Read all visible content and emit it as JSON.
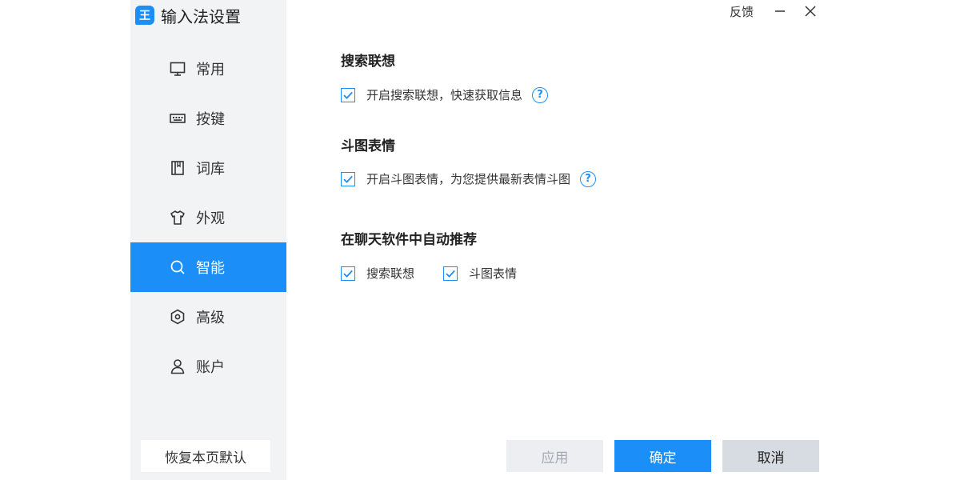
{
  "app": {
    "title": "输入法设置",
    "logo_glyph": "王",
    "accent": "#1b8ff7"
  },
  "topbar": {
    "feedback": "反馈"
  },
  "sidebar": {
    "items": [
      {
        "label": "常用",
        "icon": "monitor-icon"
      },
      {
        "label": "按键",
        "icon": "keyboard-icon"
      },
      {
        "label": "词库",
        "icon": "book-icon"
      },
      {
        "label": "外观",
        "icon": "shirt-icon"
      },
      {
        "label": "智能",
        "icon": "search-icon",
        "active": true
      },
      {
        "label": "高级",
        "icon": "hexagon-icon"
      },
      {
        "label": "账户",
        "icon": "user-icon"
      }
    ],
    "restore_label": "恢复本页默认"
  },
  "sections": {
    "search": {
      "title": "搜索联想",
      "option": "开启搜索联想，快速获取信息",
      "checked": true
    },
    "sticker": {
      "title": "斗图表情",
      "option": "开启斗图表情，为您提供最新表情斗图",
      "checked": true
    },
    "auto": {
      "title": "在聊天软件中自动推荐",
      "option1": "搜索联想",
      "option2": "斗图表情",
      "checked1": true,
      "checked2": true
    }
  },
  "buttons": {
    "apply": "应用",
    "ok": "确定",
    "cancel": "取消"
  },
  "help_glyph": "?"
}
